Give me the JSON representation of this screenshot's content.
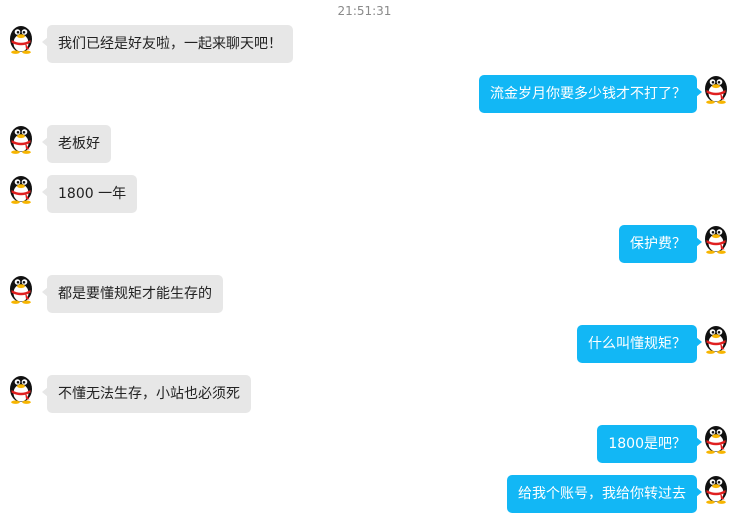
{
  "chat": {
    "timestamp": "21:51:31",
    "messages": [
      {
        "side": "left",
        "text": "我们已经是好友啦，一起来聊天吧！"
      },
      {
        "side": "right",
        "text": "流金岁月你要多少钱才不打了？"
      },
      {
        "side": "left",
        "text": "老板好"
      },
      {
        "side": "left",
        "text": "1800 一年"
      },
      {
        "side": "right",
        "text": "保护费？"
      },
      {
        "side": "left",
        "text": "都是要懂规矩才能生存的"
      },
      {
        "side": "right",
        "text": "什么叫懂规矩？"
      },
      {
        "side": "left",
        "text": "不懂无法生存，小站也必须死"
      },
      {
        "side": "right",
        "text": "1800是吧？"
      },
      {
        "side": "right",
        "text": "给我个账号，我给你转过去"
      }
    ]
  },
  "avatar_icon": "qq-penguin-icon",
  "colors": {
    "incoming_bubble": "#e7e7e7",
    "outgoing_bubble": "#12b7f5",
    "timestamp_text": "#8a8a8a"
  }
}
